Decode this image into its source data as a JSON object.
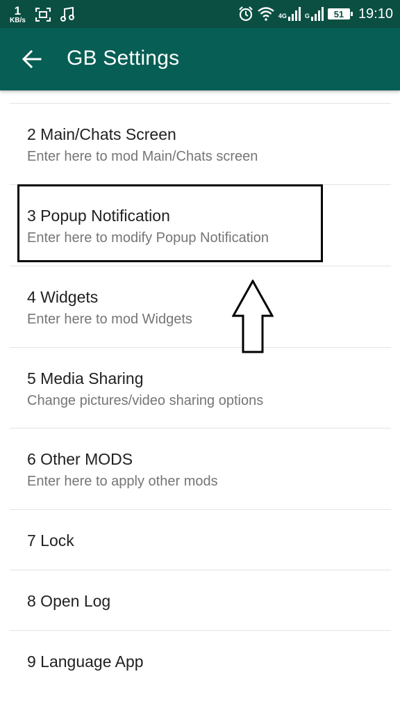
{
  "status_bar": {
    "net_speed_value": "1",
    "net_speed_unit": "KB/s",
    "net_label_1": "4G",
    "net_label_2": "G",
    "battery": "51",
    "time": "19:10"
  },
  "app_bar": {
    "title": "GB Settings"
  },
  "items": [
    {
      "label": "2 Main/Chats Screen",
      "sub": "Enter here to mod Main/Chats screen"
    },
    {
      "label": "3 Popup Notification",
      "sub": "Enter here to modify Popup Notification"
    },
    {
      "label": "4 Widgets",
      "sub": "Enter here to mod Widgets"
    },
    {
      "label": "5 Media Sharing",
      "sub": "Change pictures/video sharing options"
    },
    {
      "label": "6 Other MODS",
      "sub": "Enter here to apply other mods"
    },
    {
      "label": "7 Lock"
    },
    {
      "label": "8 Open Log"
    },
    {
      "label": "9 Language App"
    }
  ]
}
